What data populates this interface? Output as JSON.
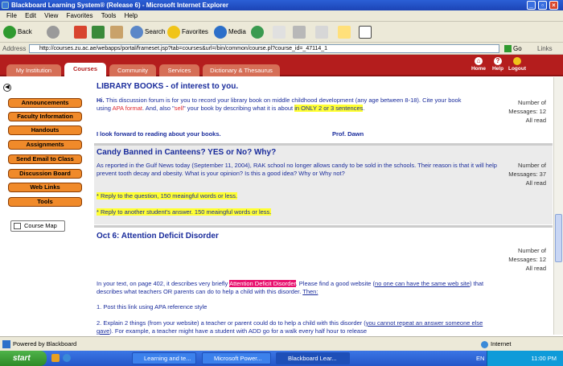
{
  "window": {
    "title": "Blackboard Learning System® (Release 6) - Microsoft Internet Explorer"
  },
  "menu": [
    "File",
    "Edit",
    "View",
    "Favorites",
    "Tools",
    "Help"
  ],
  "toolbar": {
    "back": "Back",
    "search": "Search",
    "favorites": "Favorites",
    "media": "Media"
  },
  "address": {
    "label": "Address",
    "url": "http://courses.zu.ac.ae/webapps/portal/frameset.jsp?tab=courses&url=/bin/common/course.pl?course_id=_47114_1",
    "go": "Go",
    "links": "Links"
  },
  "bb_tabs": [
    "My Institution",
    "Courses",
    "Community",
    "Services",
    "Dictionary & Thesaurus"
  ],
  "bb_top_icons": [
    "Home",
    "Help",
    "Logout"
  ],
  "leftnav": [
    "Announcements",
    "Faculty Information",
    "Handouts",
    "Assignments",
    "Send Email to Class",
    "Discussion Board",
    "Web Links",
    "Tools"
  ],
  "coursemap": "Course Map",
  "forums": {
    "f1": {
      "title": "LIBRARY BOOKS - of interest to you.",
      "hi": "Hi.",
      "line1": " This discussion forum is for you to record your library book on middle childhood development (any age between 8-18).",
      "line2a": "Cite your book using ",
      "apa": "APA format",
      "line2b": ".  And, also \"",
      "sell": "sell",
      "line2c": "\" your book by describing what it is about ",
      "hl": "in ONLY 2 or 3 sentences",
      "line2d": ".",
      "line3": "I look forward to reading about your books.",
      "sig": "Prof. Dawn",
      "meta1": "Number of",
      "meta2": "Messages: 12",
      "meta3": "All read"
    },
    "f2": {
      "title": "Candy Banned in Canteens? YES or No? Why?",
      "body": "As reported in the Gulf News today (September 11, 2004), RAK school no longer allows candy to be sold in the schools. Their reason is that it will help prevent tooth decay and obesity.  What is your opinion?  Is this a good idea?  Why or Why not?",
      "reply1": "* Reply to the question,  150 meaingful words or less.",
      "reply2": "* Reply to another student's answer.   150 meaingful words or less.",
      "meta1": "Number of",
      "meta2": "Messages: 37",
      "meta3": "All read"
    },
    "f3": {
      "title": "Oct 6: Attention Deficit Disorder",
      "meta1": "Number of",
      "meta2": "Messages: 12",
      "meta3": "All read",
      "p1a": "In your text, on page 402, it describes very briefly ",
      "p1hl": "Attention Deficit Disorder",
      "p1b": ".  Please find a good website (",
      "p1u": "no one can have the same web site",
      "p1c": ") that describes what teachers OR parents can do to help a child with this disorder.  ",
      "p1then": "Then:",
      "item1": "1.   Post this link using APA reference style",
      "item2a": "2.   Explain 2 things (from your website) a teacher or parent could do to help a child with this disorder (",
      "item2u": "you cannot repeat an answer someone else gave",
      "item2b": ").  For example, a teacher might have a student with ADD go for a walk every half hour to release"
    }
  },
  "status": {
    "left": "Powered by Blackboard",
    "zone": "Internet"
  },
  "taskbar": {
    "start": "start",
    "tasks": [
      "Learning and te...",
      "Microsoft Power...",
      "Blackboard Lear..."
    ],
    "lang": "EN",
    "time": "11:00 PM"
  }
}
